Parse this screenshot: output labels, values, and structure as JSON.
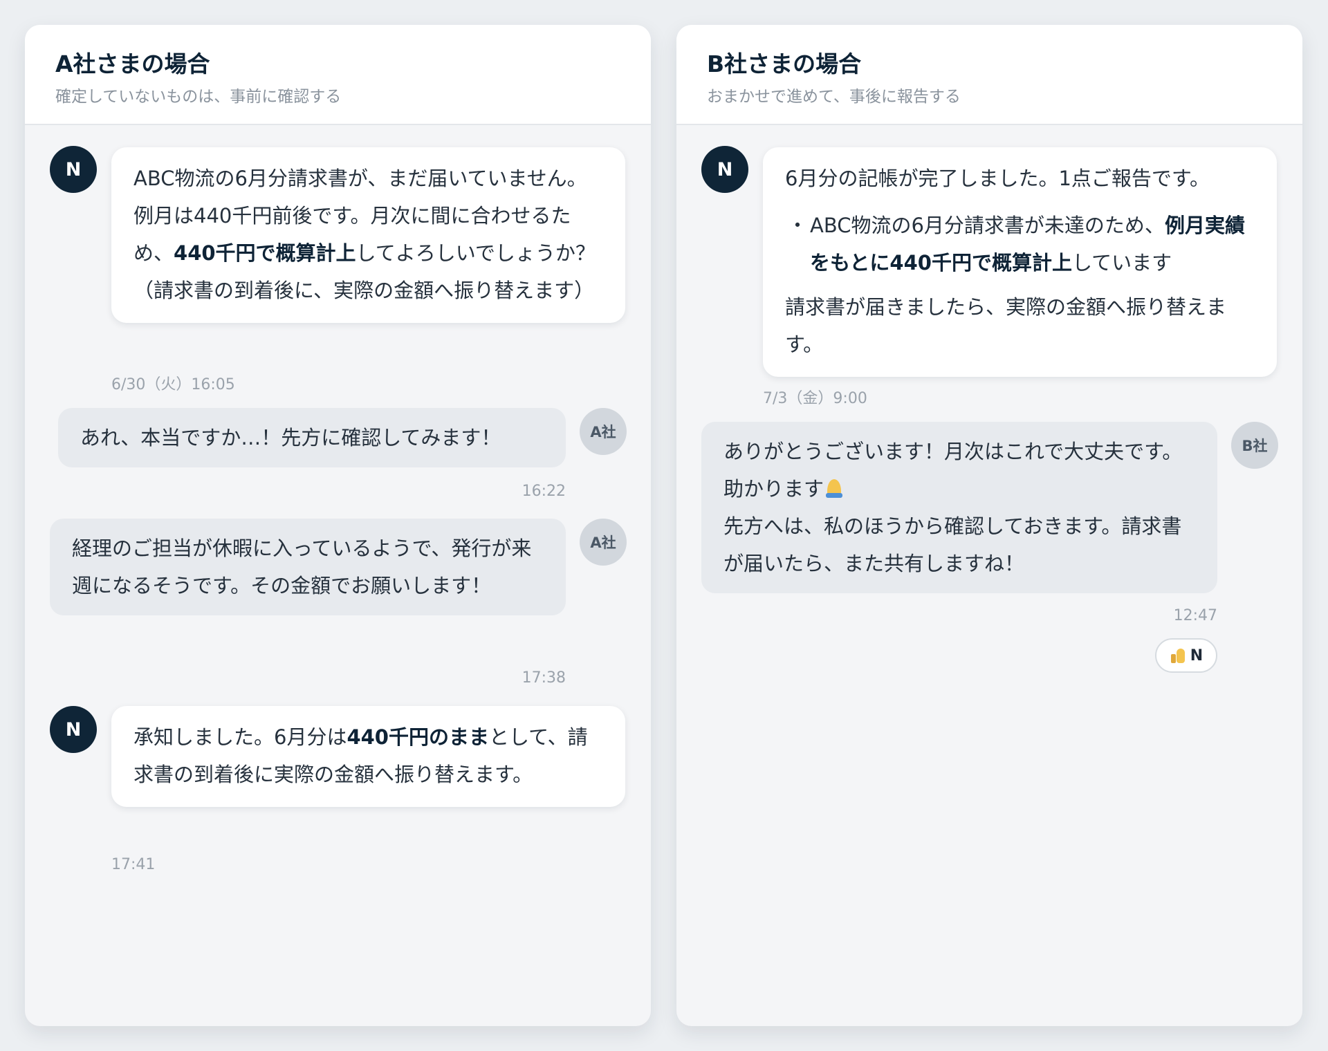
{
  "panels": [
    {
      "title": "A社さまの場合",
      "subtitle": "確定していないものは、事前に確認する",
      "messages": [
        {
          "avatar": "N",
          "parts": [
            "ABC物流の6月分請求書が、まだ届いていません。例月は440千円前後です。月次に間に合わせるため、",
            "440千円で概算計上",
            "してよろしいでしょうか？（請求書の到着後に、実際の金額へ振り替えます）"
          ],
          "time": "6/30（火）16:05"
        },
        {
          "avatar": "A社",
          "text": "あれ、本当ですか…！先方に確認してみます！",
          "time": "16:22"
        },
        {
          "avatar": "A社",
          "text": "経理のご担当が休暇に入っているようで、発行が来週になるそうです。その金額でお願いします！",
          "time": "17:38"
        },
        {
          "avatar": "N",
          "parts": [
            "承知しました。6月分は",
            "440千円のまま",
            "として、請求書の到着後に実際の金額へ振り替えます。"
          ],
          "time": "17:41"
        }
      ]
    },
    {
      "title": "B社さまの場合",
      "subtitle": "おまかせで進めて、事後に報告する",
      "messages": [
        {
          "avatar": "N",
          "intro": "6月分の記帳が完了しました。1点ご報告です。",
          "bullet_marker": "・",
          "bullet_parts": [
            "ABC物流の6月分請求書が未達のため、",
            "例月実績をもとに440千円で概算計上",
            "しています"
          ],
          "closing": "請求書が届きましたら、実際の金額へ振り替えます。",
          "time": "7/3（金）9:00"
        },
        {
          "avatar": "B社",
          "line1": "ありがとうございます！月次はこれで大丈夫です。助かります",
          "line2": "先方へは、私のほうから確認しておきます。請求書が届いたら、また共有しますね！",
          "time": "12:47",
          "reaction": {
            "emoji": "thumbs-up-icon",
            "user": "N"
          }
        }
      ]
    }
  ]
}
